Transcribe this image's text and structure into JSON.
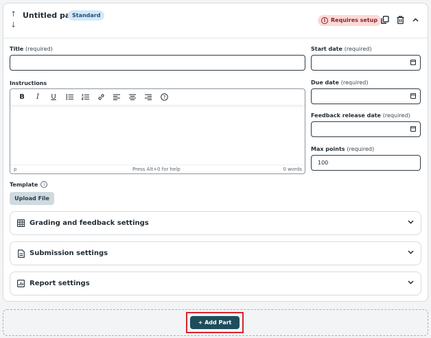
{
  "header": {
    "part_title": "Untitled part",
    "badge": "Standard",
    "status": "Requires setup",
    "status_icon": "info-icon",
    "up_icon": "↑",
    "down_icon": "↓"
  },
  "form": {
    "title": {
      "label": "Title",
      "required": "(required)",
      "value": ""
    },
    "instructions": {
      "label": "Instructions"
    },
    "start_date": {
      "label": "Start date",
      "required": "(required)",
      "value": ""
    },
    "due_date": {
      "label": "Due date",
      "required": "(required)",
      "value": ""
    },
    "feedback_date": {
      "label": "Feedback release date",
      "required": "(required)",
      "value": ""
    },
    "max_points": {
      "label": "Max points",
      "required": "(required)",
      "value": "100"
    }
  },
  "editor": {
    "toolbar": [
      "bold",
      "italic",
      "underline",
      "bullet-list",
      "numbered-list",
      "link",
      "align-left",
      "align-center",
      "align-right",
      "help"
    ],
    "toolbar_glyphs": {
      "bold": "B",
      "italic": "I",
      "underline": "U",
      "bullet": "☰",
      "numbered": "☷",
      "link": "🔗",
      "align_left": "≡",
      "align_center": "≡",
      "align_right": "≡",
      "help": "?"
    },
    "status_path": "p",
    "status_help": "Press Alt+0 for help",
    "status_words": "0 words"
  },
  "template": {
    "label": "Template",
    "upload_label": "Upload File"
  },
  "accordions": [
    {
      "label": "Grading and feedback settings",
      "icon": "grid-icon"
    },
    {
      "label": "Submission settings",
      "icon": "document-icon"
    },
    {
      "label": "Report settings",
      "icon": "report-icon"
    }
  ],
  "add_part": {
    "label": "+ Add Part"
  },
  "colors": {
    "primary": "#1e4d5c",
    "badge_bg": "#d6e8f8",
    "status_bg": "#fcd9d9",
    "highlight": "#d6252d"
  }
}
